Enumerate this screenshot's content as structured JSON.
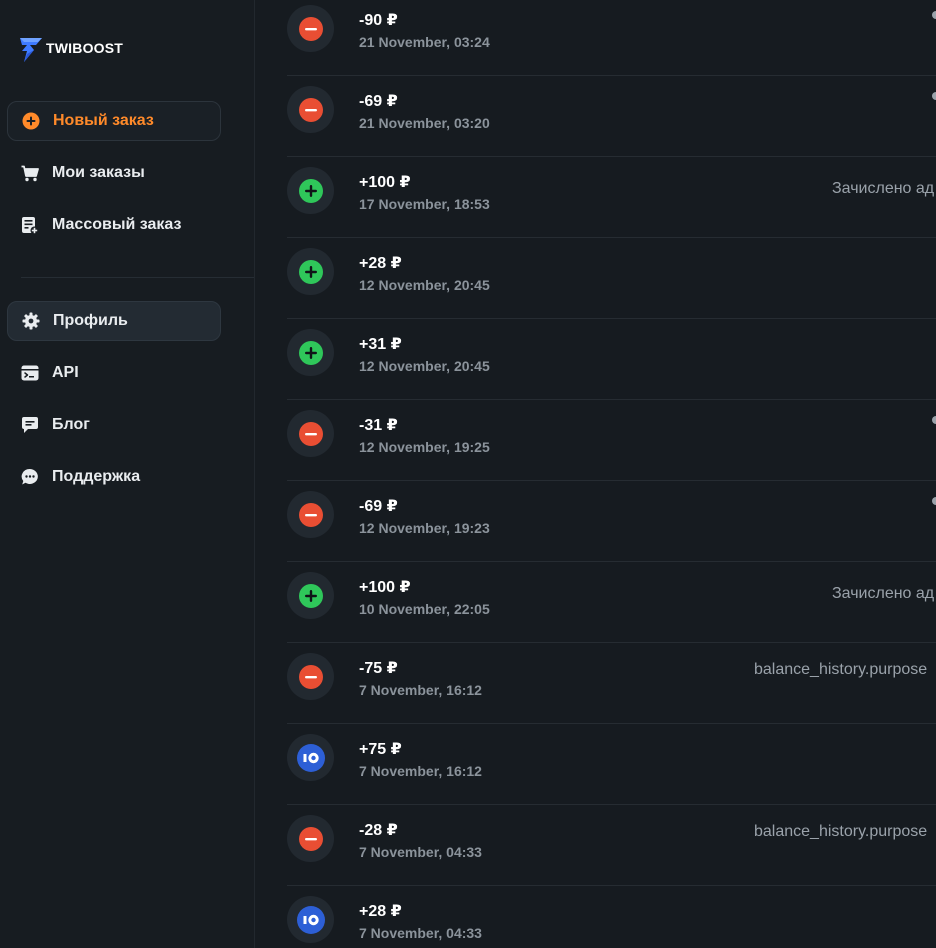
{
  "brand": {
    "name": "TWIBOOST",
    "accent": "#ff8a2a"
  },
  "sidebar": {
    "items": [
      {
        "label": "Новый заказ",
        "icon": "plus-circle-icon"
      },
      {
        "label": "Мои заказы",
        "icon": "cart-icon"
      },
      {
        "label": "Массовый заказ",
        "icon": "bulk-order-icon"
      },
      {
        "label": "Профиль",
        "icon": "gear-icon"
      },
      {
        "label": "API",
        "icon": "terminal-icon"
      },
      {
        "label": "Блог",
        "icon": "chat-icon"
      },
      {
        "label": "Поддержка",
        "icon": "support-chat-icon"
      }
    ]
  },
  "history": [
    {
      "amount": "-90 ₽",
      "date": "21 November, 03:24",
      "type": "minus",
      "purpose": ""
    },
    {
      "amount": "-69 ₽",
      "date": "21 November, 03:20",
      "type": "minus",
      "purpose": ""
    },
    {
      "amount": "+100 ₽",
      "date": "17 November, 18:53",
      "type": "plus",
      "purpose": "Зачислено ад"
    },
    {
      "amount": "+28 ₽",
      "date": "12 November, 20:45",
      "type": "plus",
      "purpose": ""
    },
    {
      "amount": "+31 ₽",
      "date": "12 November, 20:45",
      "type": "plus",
      "purpose": ""
    },
    {
      "amount": "-31 ₽",
      "date": "12 November, 19:25",
      "type": "minus",
      "purpose": ""
    },
    {
      "amount": "-69 ₽",
      "date": "12 November, 19:23",
      "type": "minus",
      "purpose": ""
    },
    {
      "amount": "+100 ₽",
      "date": "10 November, 22:05",
      "type": "plus",
      "purpose": "Зачислено ад"
    },
    {
      "amount": "-75 ₽",
      "date": "7 November, 16:12",
      "type": "minus",
      "purpose": "balance_history.purpose"
    },
    {
      "amount": "+75 ₽",
      "date": "7 November, 16:12",
      "type": "yoomoney",
      "purpose": ""
    },
    {
      "amount": "-28 ₽",
      "date": "7 November, 04:33",
      "type": "minus",
      "purpose": "balance_history.purpose"
    },
    {
      "amount": "+28 ₽",
      "date": "7 November, 04:33",
      "type": "yoomoney",
      "purpose": ""
    }
  ],
  "colors": {
    "minus": "#e94e33",
    "plus": "#2fc75a",
    "yoomoney": "#2d5fd6"
  }
}
